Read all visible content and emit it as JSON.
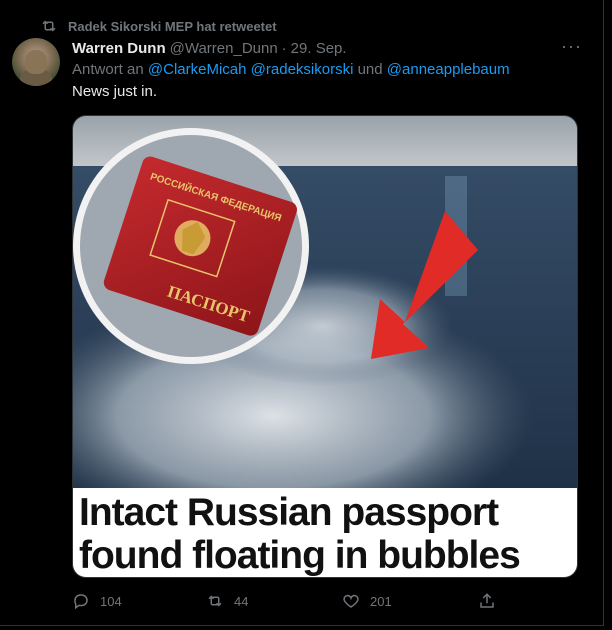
{
  "retweet_banner": {
    "text": "Radek Sikorski MEP hat retweetet"
  },
  "author": {
    "name": "Warren Dunn",
    "handle": "@Warren_Dunn",
    "separator": "·",
    "date": "29. Sep."
  },
  "more_label": "···",
  "reply": {
    "prefix": "Antwort an",
    "mention1": "@ClarkeMicah",
    "mention2": "@radeksikorski",
    "conjunction": "und",
    "mention3": "@anneapplebaum"
  },
  "tweet_text": "News just in.",
  "media": {
    "passport_top_text": "РОССИЙСКАЯ ФЕДЕРАЦИЯ",
    "passport_bottom_text": "ПАСПОРТ",
    "caption_line1": "Intact Russian passport",
    "caption_line2": "found floating in bubbles"
  },
  "actions": {
    "replies": "104",
    "retweets": "44",
    "likes": "201"
  },
  "colors": {
    "background": "#000000",
    "link": "#1d9bf0",
    "muted": "#71767b",
    "passport_red": "#a81c22",
    "arrow_red": "#e02b27"
  }
}
